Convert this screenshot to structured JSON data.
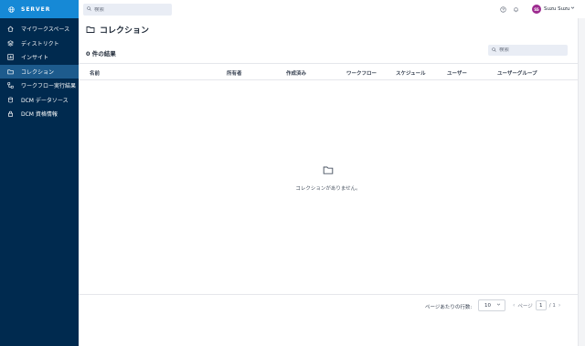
{
  "brand": {
    "name": "SERVER"
  },
  "sidebar": {
    "items": [
      {
        "label": "マイワークスペース",
        "icon": "home-icon",
        "active": false
      },
      {
        "label": "ディストリクト",
        "icon": "district-icon",
        "active": false
      },
      {
        "label": "インサイト",
        "icon": "insight-icon",
        "active": false
      },
      {
        "label": "コレクション",
        "icon": "folder-icon",
        "active": true
      },
      {
        "label": "ワークフロー実行結果",
        "icon": "workflow-results-icon",
        "active": false
      },
      {
        "label": "DCM データソース",
        "icon": "datasource-icon",
        "active": false
      },
      {
        "label": "DCM 資格情報",
        "icon": "lock-icon",
        "active": false
      }
    ]
  },
  "topbar": {
    "search_placeholder": "検索",
    "user_initials": "SS",
    "user_name": "Suzu Suzu"
  },
  "page": {
    "title": "コレクション",
    "results": "0 件の結果",
    "search_placeholder": "検索",
    "columns": [
      "名前",
      "所有者",
      "作成済み",
      "ワークフロー",
      "スケジュール",
      "ユーザー",
      "ユーザーグループ"
    ],
    "empty_text": "コレクションがありません。"
  },
  "footer": {
    "rows_per_page_label": "ページあたりの行数:",
    "rows_per_page": "10",
    "page_label": "ページ",
    "current_page": "1",
    "total_pages": "/ 1"
  },
  "colors": {
    "sidebar_bg": "#002a4f",
    "brand_bg": "#1689d6",
    "active_item": "#1d5b8d",
    "avatar": "#9d2a8f"
  }
}
